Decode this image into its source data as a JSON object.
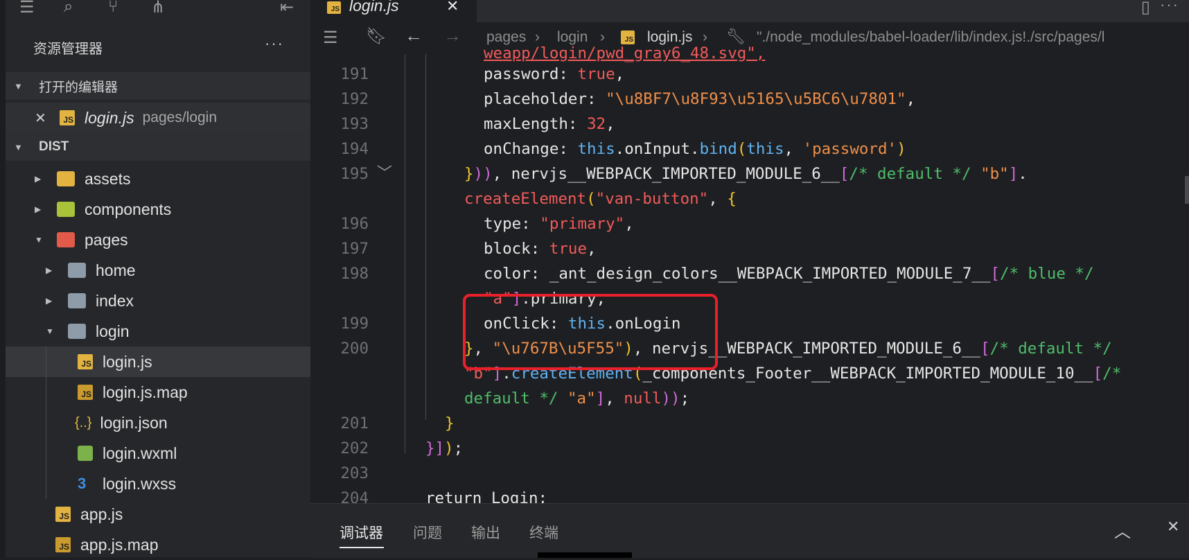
{
  "sidebar": {
    "title": "资源管理器",
    "more": "···",
    "open_editors_label": "打开的编辑器",
    "open_editor": {
      "close": "✕",
      "name": "login.js",
      "path": "pages/login"
    },
    "dist_label": "DIST",
    "tree": [
      {
        "label": "assets"
      },
      {
        "label": "components"
      },
      {
        "label": "pages"
      },
      {
        "label": "home"
      },
      {
        "label": "index"
      },
      {
        "label": "login"
      },
      {
        "label": "login.js"
      },
      {
        "label": "login.js.map"
      },
      {
        "label": "login.json"
      },
      {
        "label": "login.wxml"
      },
      {
        "label": "login.wxss"
      },
      {
        "label": "app.js"
      },
      {
        "label": "app.js.map"
      }
    ]
  },
  "tab": {
    "name": "login.js",
    "close": "✕"
  },
  "breadcrumb": {
    "p1": "pages",
    "p2": "login",
    "p3": "login.js",
    "p4": "\"./node_modules/babel-loader/lib/index.js!./src/pages/l"
  },
  "code": {
    "line0": "weapp/login/pwd_gray6_48.svg\",",
    "l191": "191",
    "l192": "192",
    "l193": "193",
    "l194": "194",
    "l195": "195",
    "l196": "196",
    "l197": "197",
    "l198": "198",
    "l199": "199",
    "l200": "200",
    "l201": "201",
    "l202": "202",
    "l203": "203",
    "l204": "204",
    "password_key": "password: ",
    "true": "true",
    "placeholder_key": "placeholder: ",
    "placeholder_val": "\"\\u8BF7\\u8F93\\u5165\\u5BC6\\u7801\"",
    "maxlen_key": "maxLength: ",
    "maxlen_val": "32",
    "onchange_key": "onChange: ",
    "this": "this",
    "oninput": ".onInput.",
    "bind": "bind",
    "password_str": "'password'",
    "nerv6": "nervjs__WEBPACK_IMPORTED_MODULE_6__",
    "default_cmt": "/* default */",
    "b_str": "\"b\"",
    "createElement": "createElement",
    "van_button": "\"van-button\"",
    "type_key": "type: ",
    "primary_str": "\"primary\"",
    "block_key": "block: ",
    "color_key": "color: ",
    "ant_mod": "_ant_design_colors__WEBPACK_IMPORTED_MODULE_7__",
    "blue_cmt": "/* blue */",
    "a_str": "\"a\"",
    "primary_prop": ".primary,",
    "onclick_key": "onClick: ",
    "onlogin": ".onLogin",
    "login_str": "\"\\u767B\\u5F55\"",
    "footer_mod": "_components_Footer__WEBPACK_IMPORTED_MODULE_10__",
    "default_cmt2": "default */",
    "null": "null",
    "return_kw": "return Login;"
  },
  "panel": {
    "tabs": [
      "调试器",
      "问题",
      "输出",
      "终端"
    ],
    "collapse": "︿",
    "close": "✕"
  },
  "colors": {
    "highlight_box": "#e8202a",
    "js_badge": "#e3b341"
  }
}
